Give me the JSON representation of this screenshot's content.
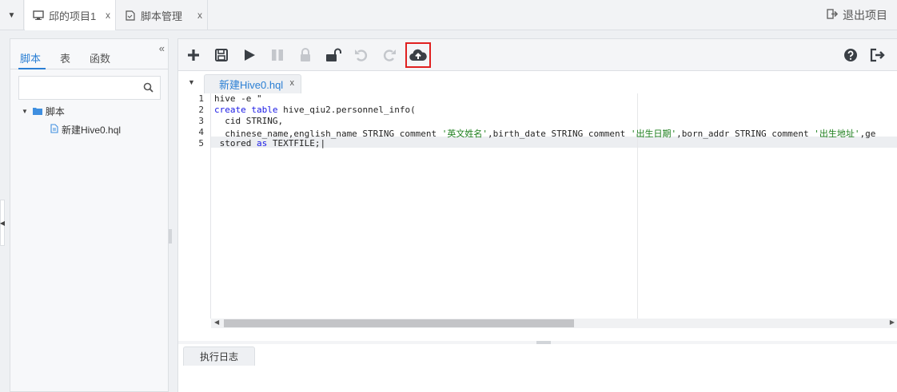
{
  "project_tabs": [
    {
      "label": "邱的项目1",
      "icon": "monitor-icon",
      "active": true
    },
    {
      "label": "脚本管理",
      "icon": "script-icon",
      "active": false
    }
  ],
  "close_glyph": "x",
  "exit_label": "退出项目",
  "left_tabs": [
    "脚本",
    "表",
    "函数"
  ],
  "search": {
    "placeholder": "",
    "value": ""
  },
  "tree": {
    "folder": "脚本",
    "file": "新建Hive0.hql"
  },
  "file_tab": {
    "label": "新建Hive0.hql"
  },
  "code_lines": [
    "1",
    "2",
    "3",
    "4",
    "5"
  ],
  "log_tab": "执行日志",
  "toolbar_icons": [
    "plus-icon",
    "save-icon",
    "play-icon",
    "pause-icon",
    "lock-icon",
    "unlock-icon",
    "undo-icon",
    "redo-icon",
    "cloud-upload-icon",
    "help-icon",
    "exit-icon"
  ],
  "colors": {
    "accent": "#2b7fd4",
    "highlight_border": "#e02020",
    "keyword": "#1a1ae6",
    "string": "#1a7d1a"
  }
}
